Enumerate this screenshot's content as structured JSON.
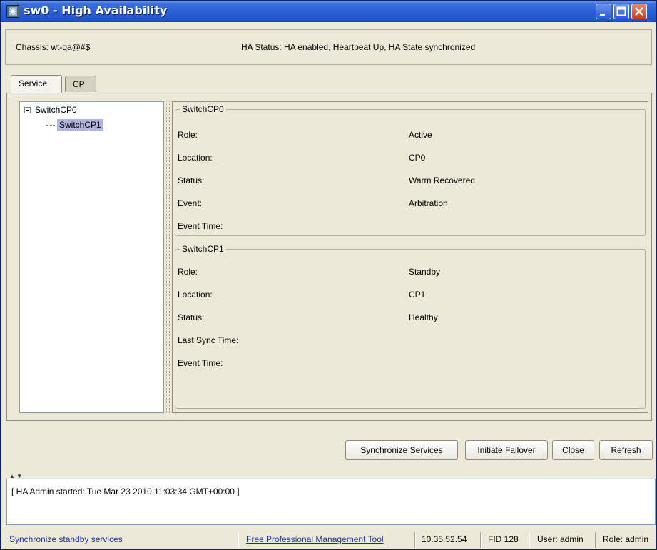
{
  "window": {
    "title": "sw0 - High Availability"
  },
  "header": {
    "chassis": "Chassis:  wt-qa@#$",
    "ha_status": "HA Status:  HA enabled, Heartbeat Up, HA State synchronized"
  },
  "tabs": [
    {
      "label": "Service",
      "active": true
    },
    {
      "label": "CP",
      "active": false
    }
  ],
  "tree": {
    "root": "SwitchCP0",
    "child": "SwitchCP1"
  },
  "groups": [
    {
      "title": "SwitchCP0",
      "fields": [
        {
          "label": "Role:",
          "value": "Active"
        },
        {
          "label": "Location:",
          "value": "CP0"
        },
        {
          "label": "Status:",
          "value": "Warm Recovered"
        },
        {
          "label": "Event:",
          "value": "Arbitration"
        },
        {
          "label": "Event Time:",
          "value": ""
        }
      ]
    },
    {
      "title": "SwitchCP1",
      "fields": [
        {
          "label": "Role:",
          "value": "Standby"
        },
        {
          "label": "Location:",
          "value": "CP1"
        },
        {
          "label": "Status:",
          "value": "Healthy"
        },
        {
          "label": "Last Sync Time:",
          "value": ""
        },
        {
          "label": "Event Time:",
          "value": ""
        }
      ]
    }
  ],
  "buttons": {
    "synchronize": "Synchronize Services",
    "failover": "Initiate Failover",
    "close": "Close",
    "refresh": "Refresh"
  },
  "log": {
    "text": "[ HA Admin started: Tue Mar 23 2010 11:03:34 GMT+00:00 ]"
  },
  "status_bar": {
    "message": "Synchronize standby services",
    "link": "Free Professional Management Tool",
    "ip": "10.35.52.54",
    "fid": "FID 128",
    "user": "User: admin",
    "role": "Role: admin"
  },
  "colors": {
    "titlebar": "#2a5fd6",
    "selection": "#b0b4e0",
    "link": "#1b2fb0"
  }
}
